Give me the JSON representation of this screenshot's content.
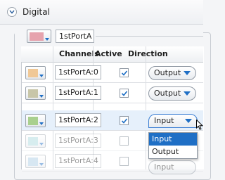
{
  "section": {
    "title": "Digital"
  },
  "port": {
    "name": "1stPortA",
    "color": "#e6a3ad"
  },
  "table": {
    "headers": {
      "channels": "Channels",
      "active": "Active",
      "direction": "Direction"
    },
    "rows": [
      {
        "channel": "1stPortA:0",
        "active": true,
        "direction": "Output",
        "color": "#f0c896"
      },
      {
        "channel": "1stPortA:1",
        "active": true,
        "direction": "Output",
        "color": "#c8c6a8"
      },
      {
        "channel": "1stPortA:2",
        "active": true,
        "direction": "Input",
        "color": "#a9d08e"
      },
      {
        "channel": "1stPortA:3",
        "active": false,
        "direction": "",
        "color": "#a8d8dc"
      },
      {
        "channel": "1stPortA:4",
        "active": false,
        "direction": "Input",
        "color": "#a8cbe3"
      }
    ]
  },
  "dropdown": {
    "options": [
      "Input",
      "Output"
    ],
    "highlighted": "Input"
  },
  "colors": {
    "accent": "#1f6fc5",
    "selected_row": "#e6f0fb"
  }
}
